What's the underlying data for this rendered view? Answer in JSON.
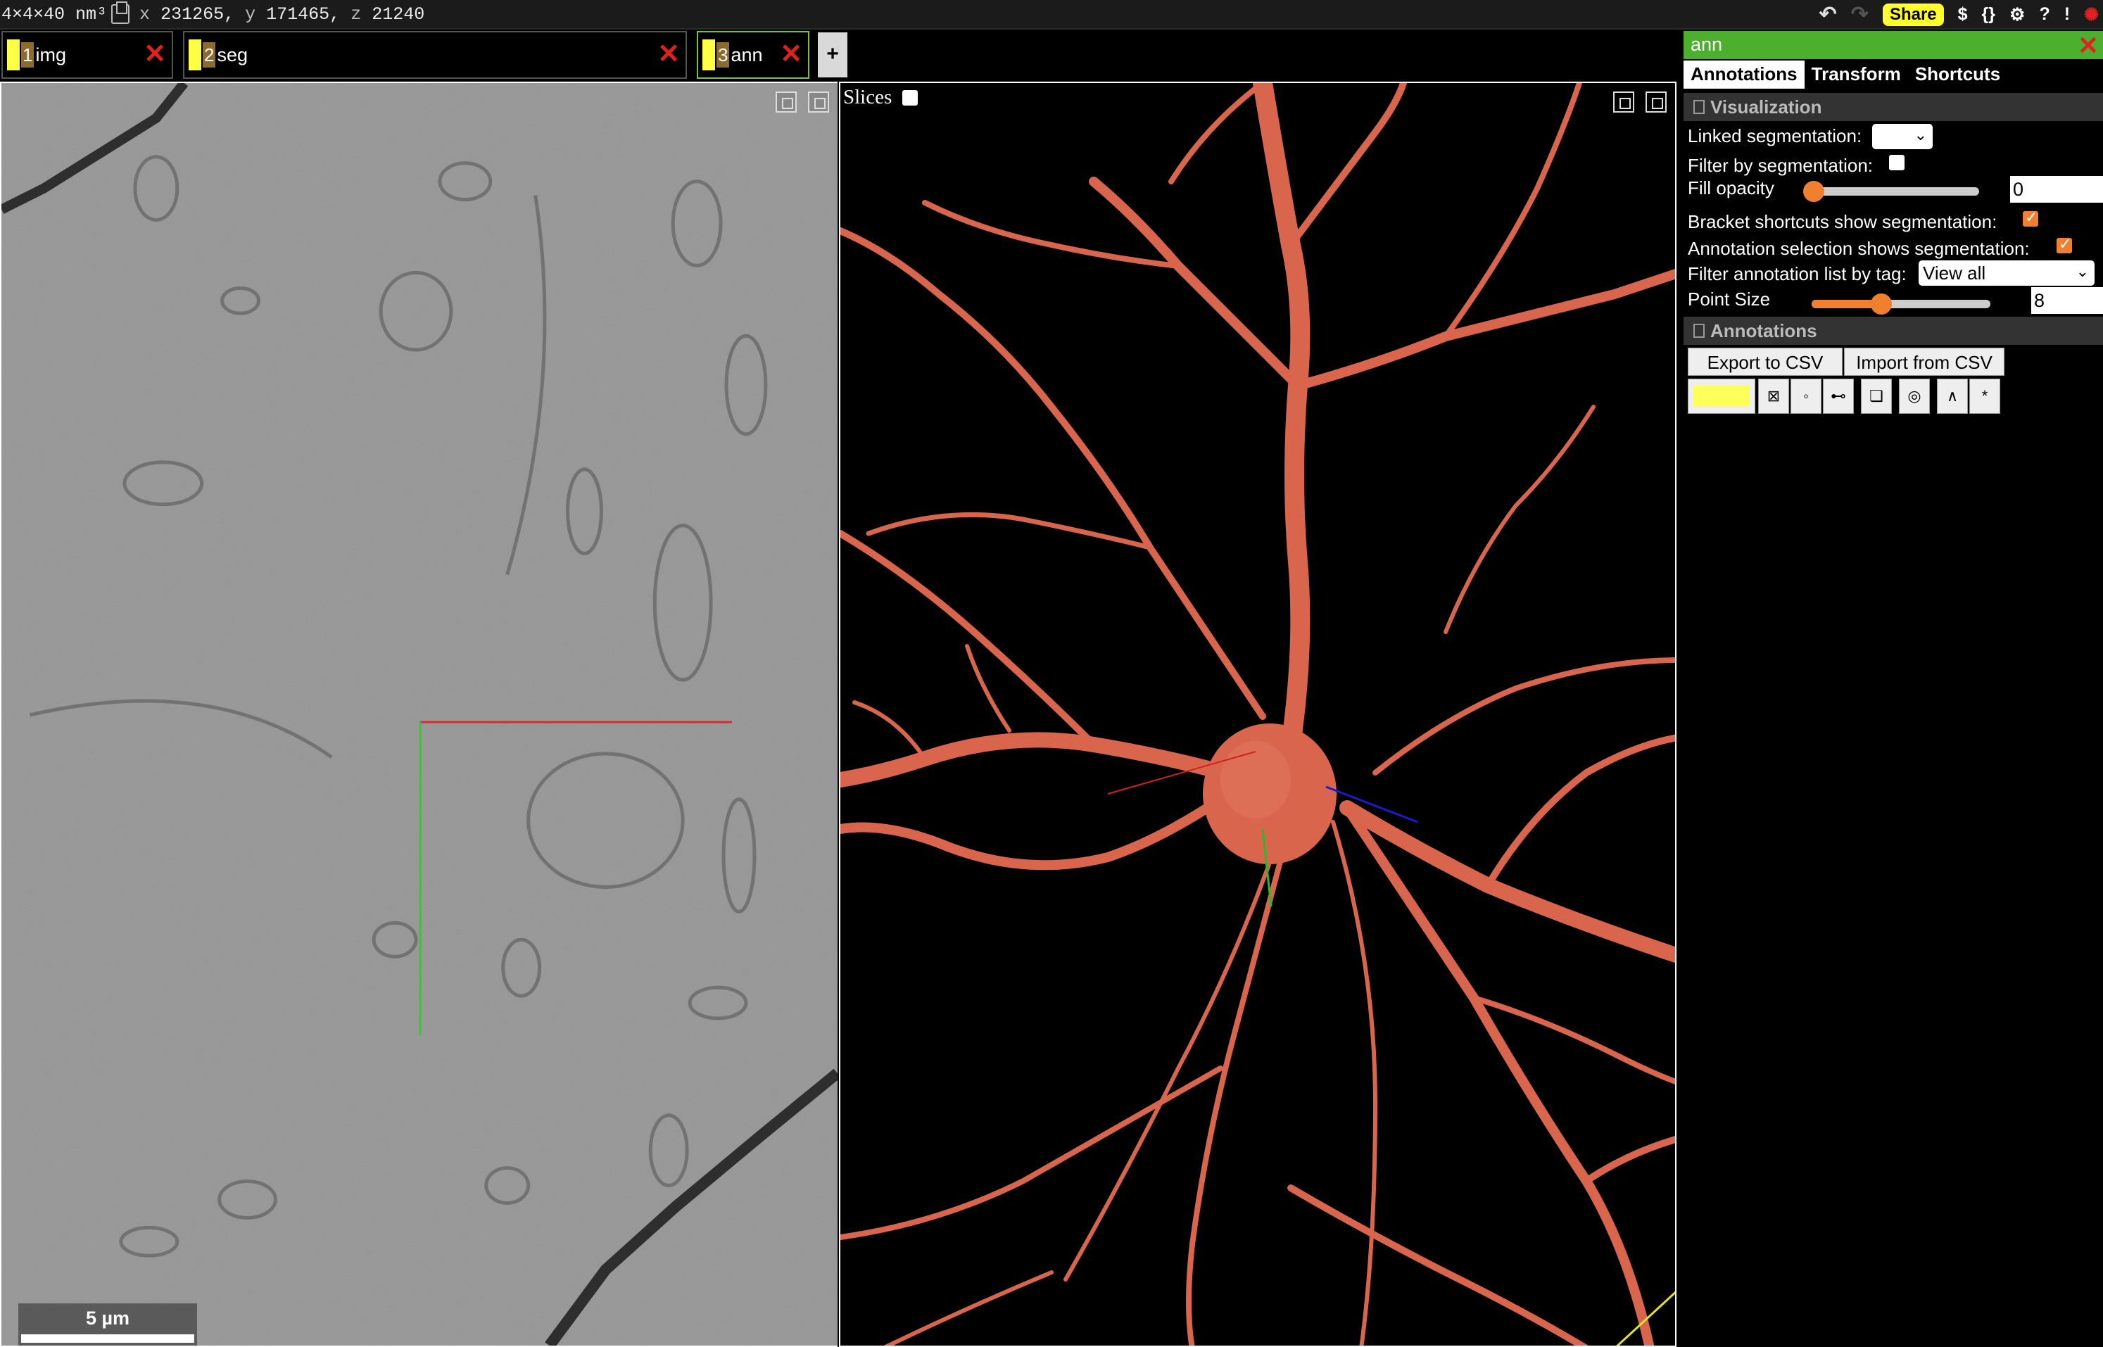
{
  "topbar": {
    "voxel_size": "4×4×40 nm³",
    "x_label": "x",
    "x_value": "231265,",
    "y_label": "y",
    "y_value": "171465,",
    "z_label": "z",
    "z_value": "21240",
    "share_label": "Share",
    "tools": [
      "$",
      "{}",
      "⚙",
      "?",
      "!"
    ]
  },
  "layers": [
    {
      "number": "1",
      "name": "img",
      "close": "✕"
    },
    {
      "number": "2",
      "name": "seg",
      "close": "✕"
    },
    {
      "number": "3",
      "name": "ann",
      "close": "✕"
    }
  ],
  "add_layer_label": "+",
  "panel_3d": {
    "slices_label": "Slices"
  },
  "scalebar": {
    "label": "5 µm"
  },
  "side_panel": {
    "title": "ann",
    "close": "✕",
    "tabs": [
      "Annotations",
      "Transform",
      "Shortcuts"
    ],
    "visualization": {
      "header": "Visualization",
      "linked_segmentation_label": "Linked segmentation:",
      "linked_segmentation_value": "",
      "filter_by_segmentation_label": "Filter by segmentation:",
      "filter_by_segmentation": false,
      "fill_opacity_label": "Fill opacity",
      "fill_opacity_value": "0",
      "bracket_shortcuts_label": "Bracket shortcuts show segmentation:",
      "bracket_shortcuts": true,
      "annotation_selection_label": "Annotation selection shows segmentation:",
      "annotation_selection": true,
      "filter_tag_label": "Filter annotation list by tag:",
      "filter_tag_value": "View all",
      "point_size_label": "Point Size",
      "point_size_value": "8"
    },
    "annotations": {
      "header": "Annotations",
      "export_label": "Export to CSV",
      "import_label": "Import from CSV",
      "color": "#ffff5a",
      "tool_icons": [
        "⊠",
        "◦",
        "⊷",
        "❏",
        "◎",
        "∧",
        "*"
      ]
    }
  },
  "colors": {
    "accent_green": "#4caf2e",
    "close_red": "#e32020",
    "neuron": "#d9654d",
    "share_yellow": "#ffff30"
  }
}
